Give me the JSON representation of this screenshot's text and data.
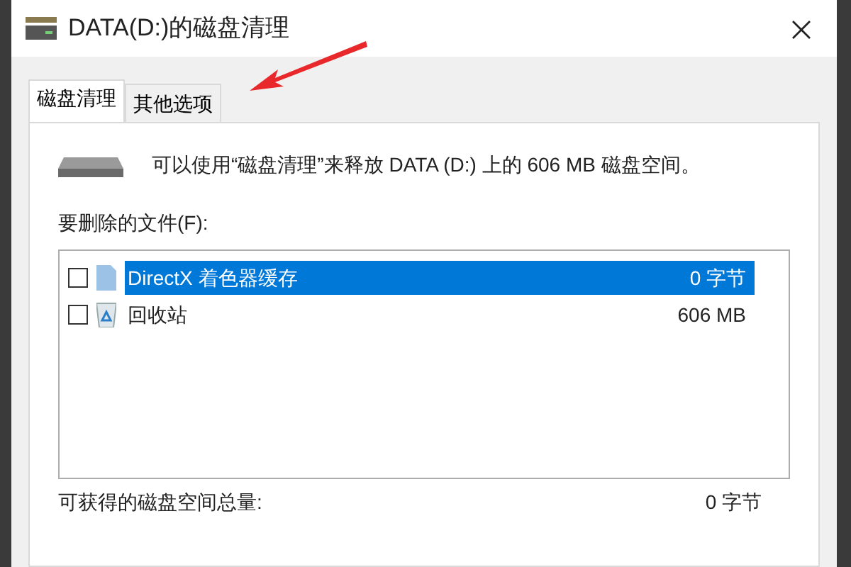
{
  "window": {
    "title": "DATA(D:)的磁盘清理"
  },
  "tabs": [
    {
      "label": "磁盘清理",
      "selected": true
    },
    {
      "label": "其他选项",
      "selected": false
    }
  ],
  "description": "可以使用“磁盘清理”来释放 DATA (D:) 上的 606 MB 磁盘空间。",
  "files_label": "要删除的文件(F):",
  "files": [
    {
      "name": "DirectX 着色器缓存",
      "size": "0 字节",
      "checked": false,
      "selected": true,
      "kind": "file"
    },
    {
      "name": "回收站",
      "size": "606 MB",
      "checked": false,
      "selected": false,
      "kind": "recycle"
    }
  ],
  "total": {
    "label": "可获得的磁盘空间总量:",
    "value": "0 字节"
  }
}
